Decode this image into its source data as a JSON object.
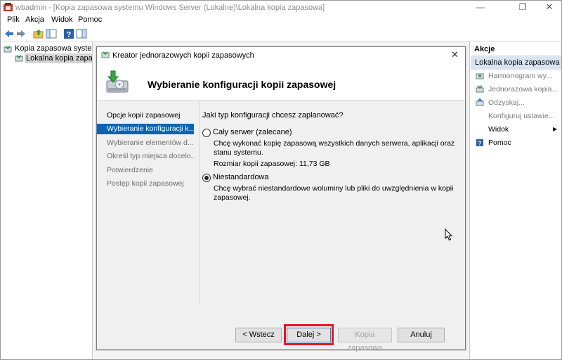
{
  "window": {
    "title": "wbadmin - [Kopia zapasowa systemu Windows Server (Lokalne)\\Lokalna kopia zapasowa]",
    "min_icon": "minimize-icon",
    "max_icon": "restore-icon",
    "close_icon": "close-icon"
  },
  "menu": [
    "Plik",
    "Akcja",
    "Widok",
    "Pomoc"
  ],
  "toolbar": {
    "icons": [
      "back-arrow-icon",
      "forward-arrow-icon",
      "up-folder-icon",
      "show-hide-tree-icon",
      "help-icon",
      "properties-icon"
    ]
  },
  "tree": {
    "root": "Kopia zapasowa systemu W",
    "child": "Lokalna kopia zapasowa"
  },
  "dialog": {
    "title": "Kreator jednorazowych kopii zapasowych",
    "header": "Wybieranie konfiguracji kopii zapasowej",
    "steps": [
      {
        "label": "Opcje kopii zapasowej",
        "state": "active"
      },
      {
        "label": "Wybieranie konfiguracji k...",
        "state": "current"
      },
      {
        "label": "Wybieranie elementów d...",
        "state": "inactive"
      },
      {
        "label": "Określ typ miejsca docelo...",
        "state": "inactive"
      },
      {
        "label": "Potwierdzenie",
        "state": "inactive"
      },
      {
        "label": "Postęp kopii zapasowej",
        "state": "inactive"
      }
    ],
    "question": "Jaki typ konfiguracji chcesz zaplanować?",
    "option_full": {
      "label": "Cały serwer (zalecane)",
      "desc": "Chcę wykonać kopię zapasową wszystkich danych serwera, aplikacji oraz stanu systemu.",
      "size": "Rozmiar kopii zapasowej: 11,73 GB",
      "checked": false
    },
    "option_custom": {
      "label": "Niestandardowa",
      "desc": "Chcę wybrać niestandardowe woluminy lub pliki do uwzględnienia w kopii zapasowej.",
      "checked": true
    },
    "buttons": {
      "back": "< Wstecz",
      "next": "Dalej >",
      "backup": "Kopia zapasowa",
      "cancel": "Anuluj"
    }
  },
  "actions": {
    "header": "Akcje",
    "sub": "Lokalna kopia zapasowa",
    "items": [
      {
        "label": "Harmonogram wy...",
        "icon": "schedule-icon",
        "dim": true
      },
      {
        "label": "Jednorazowa kopia...",
        "icon": "backup-once-icon",
        "dim": true
      },
      {
        "label": "Odzyskaj...",
        "icon": "recover-icon",
        "dim": true
      },
      {
        "label": "Konfiguruj ustawie...",
        "icon": "none",
        "dim": true
      },
      {
        "label": "Widok",
        "icon": "none",
        "dim": false
      },
      {
        "label": "Pomoc",
        "icon": "help-icon",
        "dim": false
      }
    ]
  },
  "colors": {
    "selection": "#0a64b4",
    "highlight_box": "#e8161c",
    "actions_sub_bg": "#d9e4f1"
  }
}
